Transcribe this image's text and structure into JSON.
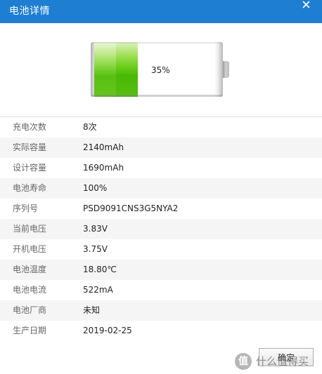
{
  "window": {
    "title": "电池详情"
  },
  "icons": {
    "close": "close-icon",
    "battery": "battery-icon"
  },
  "colors": {
    "titlebar": "#1e7fd2",
    "battery_fill": "#58c012",
    "row_alt": "#f5f5f5"
  },
  "battery": {
    "level": 0.35,
    "percent_label": "35%"
  },
  "info_rows": [
    {
      "label": "充电次数",
      "value": "8次"
    },
    {
      "label": "实际容量",
      "value": "2140mAh"
    },
    {
      "label": "设计容量",
      "value": "1690mAh"
    },
    {
      "label": "电池寿命",
      "value": "100%"
    },
    {
      "label": "序列号",
      "value": "PSD9091CNS3G5NYA2"
    },
    {
      "label": "当前电压",
      "value": "3.83V"
    },
    {
      "label": "开机电压",
      "value": "3.75V"
    },
    {
      "label": "电池温度",
      "value": "18.80℃"
    },
    {
      "label": "电池电流",
      "value": "522mA"
    },
    {
      "label": "电池厂商",
      "value": "未知"
    },
    {
      "label": "生产日期",
      "value": "2019-02-25"
    }
  ],
  "footer": {
    "ok_label": "确定"
  },
  "watermark": {
    "logo_char": "值",
    "text": "什么值得买"
  }
}
